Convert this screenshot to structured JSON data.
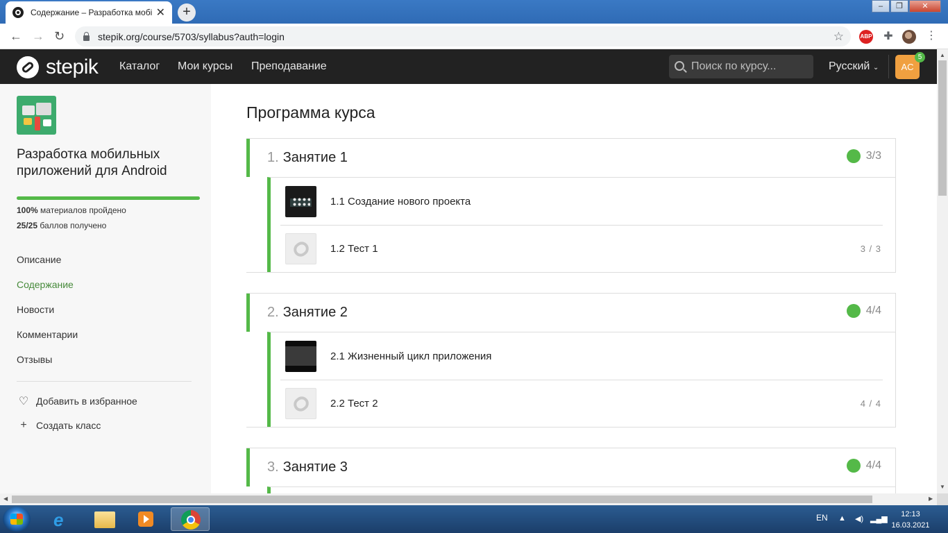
{
  "browser": {
    "tab_title": "Содержание – Разработка мобі",
    "url": "stepik.org/course/5703/syllabus?auth=login",
    "extension_abp": "ABP"
  },
  "navbar": {
    "logo": "stepik",
    "links": [
      "Каталог",
      "Мои курсы",
      "Преподавание"
    ],
    "search_placeholder": "Поиск по курсу...",
    "language": "Русский",
    "avatar_initials": "AC",
    "notifications": "5"
  },
  "sidebar": {
    "course_title": "Разработка мобильных приложений для Android",
    "progress_fraction": 1.0,
    "stat_percent": "100%",
    "stat_percent_text": "материалов пройдено",
    "stat_score": "25/25",
    "stat_score_text": "баллов получено",
    "links": [
      "Описание",
      "Содержание",
      "Новости",
      "Комментарии",
      "Отзывы"
    ],
    "active_link": "Содержание",
    "favorite": "Добавить в избранное",
    "create_class": "Создать класс"
  },
  "main": {
    "title": "Программа курса",
    "sections": [
      {
        "number": "1.",
        "title": "Занятие 1",
        "score": "3/3",
        "lessons": [
          {
            "title": "1.1 Создание нового проекта",
            "score": "",
            "thumb": "dark-grid"
          },
          {
            "title": "1.2 Тест 1",
            "score": "3 / 3",
            "thumb": "stepik-placeholder"
          }
        ]
      },
      {
        "number": "2.",
        "title": "Занятие 2",
        "score": "4/4",
        "lessons": [
          {
            "title": "2.1 Жизненный цикл приложения",
            "score": "",
            "thumb": "video"
          },
          {
            "title": "2.2 Тест 2",
            "score": "4 / 4",
            "thumb": "stepik-placeholder"
          }
        ]
      },
      {
        "number": "3.",
        "title": "Занятие 3",
        "score": "4/4",
        "lessons": []
      }
    ]
  },
  "taskbar": {
    "language": "EN",
    "time": "12:13",
    "date": "16.03.2021"
  },
  "colors": {
    "accent_green": "#54b948",
    "navbar_bg": "#222222",
    "active_link": "#468a3a",
    "avatar_bg": "#f0a040"
  }
}
